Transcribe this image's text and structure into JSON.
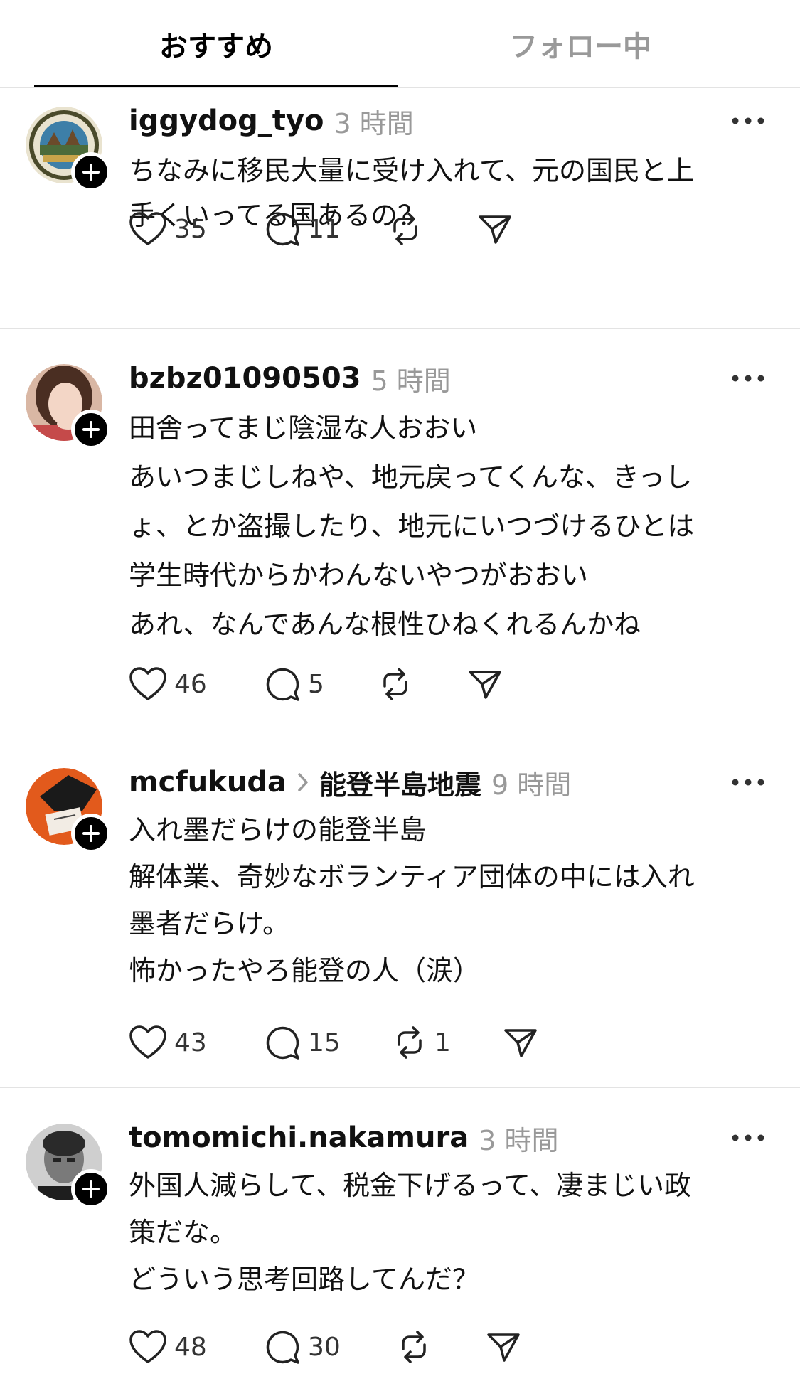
{
  "tabs": {
    "recommended": "おすすめ",
    "following": "フォロー中"
  },
  "posts": [
    {
      "username": "iggydog_tyo",
      "topic": "",
      "time": "3 時間",
      "lines": [
        "ちなみに移民大量に受け入れて、元の国民と上",
        "手くいってる国あるの？"
      ],
      "likes": "35",
      "replies": "11",
      "reposts": ""
    },
    {
      "username": "bzbz01090503",
      "topic": "",
      "time": "5 時間",
      "lines": [
        "田舎ってまじ陰湿な人おおい",
        "あいつまじしねや、地元戻ってくんな、きっし",
        "ょ、とか盗撮したり、地元にいつづけるひとは",
        "学生時代からかわんないやつがおおい",
        "あれ、なんであんな根性ひねくれるんかね"
      ],
      "likes": "46",
      "replies": "5",
      "reposts": ""
    },
    {
      "username": "mcfukuda",
      "topic": "能登半島地震",
      "time": "9 時間",
      "lines": [
        "入れ墨だらけの能登半島",
        "解体業、奇妙なボランティア団体の中には入れ",
        "墨者だらけ。",
        "怖かったやろ能登の人（涙）"
      ],
      "likes": "43",
      "replies": "15",
      "reposts": "1"
    },
    {
      "username": "tomomichi.nakamura",
      "topic": "",
      "time": "3 時間",
      "lines": [
        "外国人減らして、税金下げるって、凄まじい政",
        "策だな。",
        "どういう思考回路してんだ？"
      ],
      "likes": "48",
      "replies": "30",
      "reposts": ""
    }
  ]
}
